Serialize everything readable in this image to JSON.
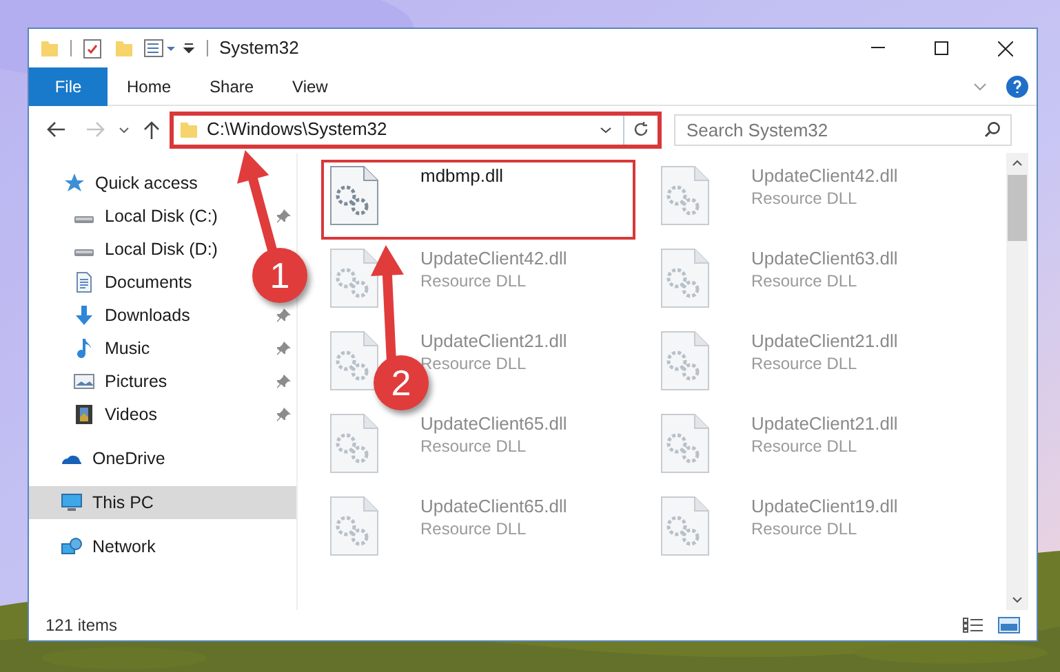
{
  "window": {
    "title": "System32"
  },
  "ribbon": {
    "tabs": [
      {
        "label": "File",
        "kind": "file",
        "selected": false
      },
      {
        "label": "Home",
        "kind": "tab",
        "selected": false
      },
      {
        "label": "Share",
        "kind": "tab",
        "selected": false
      },
      {
        "label": "View",
        "kind": "tab",
        "selected": false
      }
    ]
  },
  "navigation": {
    "forward_disabled": true
  },
  "address": {
    "path": "C:\\Windows\\System32",
    "highlighted": true
  },
  "search": {
    "placeholder": "Search System32"
  },
  "sidebar": {
    "items": [
      {
        "label": "Quick access",
        "kind": "star",
        "selected": false,
        "children": [
          {
            "label": "Local Disk (C:)",
            "kind": "disk",
            "pinned": true,
            "selected": false
          },
          {
            "label": "Local Disk (D:)",
            "kind": "disk",
            "pinned": false,
            "selected": false
          },
          {
            "label": "Documents",
            "kind": "document",
            "pinned": false,
            "selected": false
          },
          {
            "label": "Downloads",
            "kind": "download",
            "pinned": true,
            "selected": false
          },
          {
            "label": "Music",
            "kind": "music",
            "pinned": true,
            "selected": false
          },
          {
            "label": "Pictures",
            "kind": "pictures",
            "pinned": true,
            "selected": false
          },
          {
            "label": "Videos",
            "kind": "videos",
            "pinned": true,
            "selected": false
          }
        ]
      },
      {
        "label": "OneDrive",
        "kind": "cloud",
        "selected": false
      },
      {
        "label": "This PC",
        "kind": "pc",
        "selected": true
      },
      {
        "label": "Network",
        "kind": "network",
        "selected": false
      }
    ]
  },
  "files": [
    {
      "name": "mdbmp.dll",
      "faded": false,
      "highlighted": true
    },
    {
      "name": "UpdateClient42.dll",
      "type": "Resource DLL",
      "faded": true,
      "highlighted": false
    },
    {
      "name": "UpdateClient42.dll",
      "type": "Resource DLL",
      "faded": true,
      "highlighted": false
    },
    {
      "name": "UpdateClient63.dll",
      "type": "Resource DLL",
      "faded": true,
      "highlighted": false
    },
    {
      "name": "UpdateClient21.dll",
      "type": "Resource DLL",
      "faded": true,
      "highlighted": false
    },
    {
      "name": "UpdateClient21.dll",
      "type": "Resource DLL",
      "faded": true,
      "highlighted": false
    },
    {
      "name": "UpdateClient65.dll",
      "type": "Resource DLL",
      "faded": true,
      "highlighted": false
    },
    {
      "name": "UpdateClient21.dll",
      "type": "Resource DLL",
      "faded": true,
      "highlighted": false
    },
    {
      "name": "UpdateClient65.dll",
      "type": "Resource DLL",
      "faded": true,
      "highlighted": false
    },
    {
      "name": "UpdateClient19.dll",
      "type": "Resource DLL",
      "faded": true,
      "highlighted": false
    }
  ],
  "status_bar": {
    "item_count": "121 items"
  },
  "annotations": [
    {
      "label": "1"
    },
    {
      "label": "2"
    }
  ]
}
